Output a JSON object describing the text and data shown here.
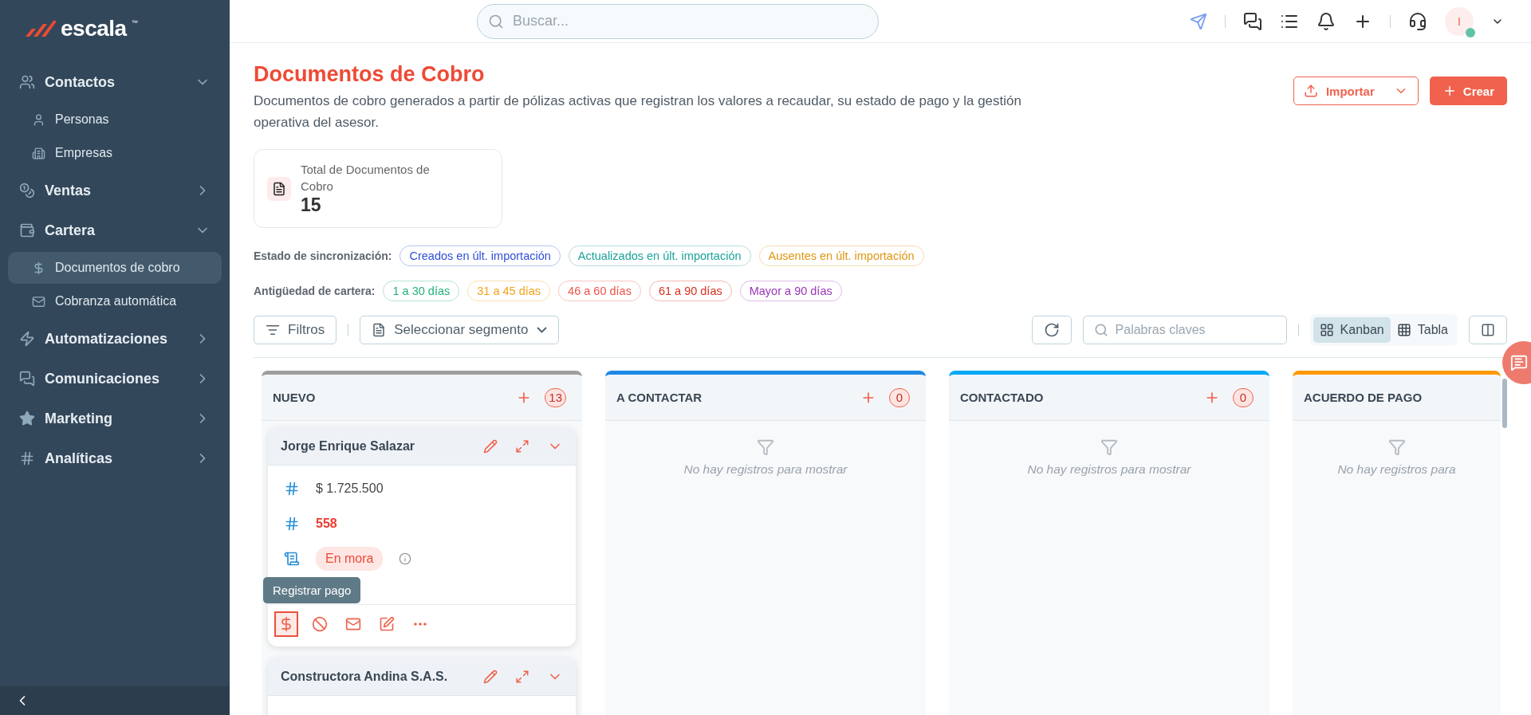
{
  "sidebar": {
    "logo": "escala",
    "trademark": "™",
    "items": [
      {
        "label": "Contactos",
        "expanded": true,
        "children": [
          {
            "label": "Personas",
            "selected": false
          },
          {
            "label": "Empresas",
            "selected": false
          }
        ]
      },
      {
        "label": "Ventas",
        "expanded": false
      },
      {
        "label": "Cartera",
        "expanded": true,
        "children": [
          {
            "label": "Documentos de cobro",
            "selected": true
          },
          {
            "label": "Cobranza automática",
            "selected": false
          }
        ]
      },
      {
        "label": "Automatizaciones",
        "expanded": false
      },
      {
        "label": "Comunicaciones",
        "expanded": false
      },
      {
        "label": "Marketing",
        "expanded": false
      },
      {
        "label": "Analíticas",
        "expanded": false
      }
    ]
  },
  "topbar": {
    "search": {
      "placeholder": "Buscar..."
    },
    "avatar": {
      "initial": "I",
      "online": true
    }
  },
  "page": {
    "title": "Documentos de Cobro",
    "description": "Documentos de cobro generados a partir de pólizas activas que registran los valores a recaudar, su estado de pago y la gestión operativa del asesor.",
    "buttons": {
      "import": "Importar",
      "create": "Crear"
    }
  },
  "stat": {
    "label": "Total de Documentos de Cobro",
    "value": "15"
  },
  "sync": {
    "label": "Estado de sincronización:",
    "tags": [
      {
        "label": "Creados en últ. importación",
        "color": "#2f4fd8"
      },
      {
        "label": "Actualizados en últ. importación",
        "color": "#1aa39a"
      },
      {
        "label": "Ausentes en últ. importación",
        "color": "#e0960e"
      }
    ]
  },
  "aging": {
    "label": "Antigüedad de cartera:",
    "tags": [
      {
        "label": "1 a 30 días",
        "color": "#21b27a"
      },
      {
        "label": "31 a 45 días",
        "color": "#f2a21b"
      },
      {
        "label": "46 a 60 días",
        "color": "#f0524a"
      },
      {
        "label": "61 a 90 días",
        "color": "#d8301c"
      },
      {
        "label": "Mayor a 90 días",
        "color": "#9c35b8"
      }
    ]
  },
  "toolbar": {
    "filters": "Filtros",
    "segment": "Seleccionar segmento",
    "keywords": {
      "placeholder": "Palabras claves"
    },
    "views": [
      {
        "label": "Kanban",
        "selected": true
      },
      {
        "label": "Tabla",
        "selected": false
      }
    ]
  },
  "board": {
    "columns": [
      {
        "title": "NUEVO",
        "color": "#9e9e9e",
        "count": "13",
        "cards": [
          {
            "name": "Jorge Enrique Salazar",
            "fields": [
              {
                "kind": "amount",
                "value": "$ 1.725.500"
              },
              {
                "kind": "number",
                "value": "558"
              },
              {
                "kind": "status",
                "value": "En mora"
              }
            ],
            "tooltip": "Registrar pago"
          },
          {
            "name": "Constructora Andina S.A.S."
          }
        ]
      },
      {
        "title": "A CONTACTAR",
        "color": "#1e88e5",
        "count": "0",
        "empty": "No hay registros para mostrar"
      },
      {
        "title": "CONTACTADO",
        "color": "#03a9f4",
        "count": "0",
        "empty": "No hay registros para mostrar"
      },
      {
        "title": "ACUERDO DE PAGO",
        "color": "#ff9800",
        "empty": "No hay registros para"
      }
    ]
  }
}
